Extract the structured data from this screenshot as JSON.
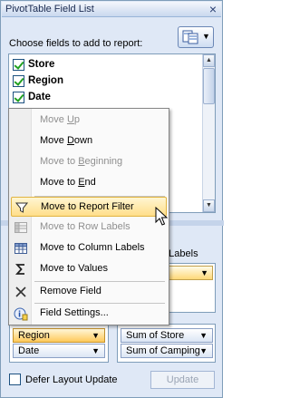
{
  "pane": {
    "title": "PivotTable Field List",
    "close_glyph": "×",
    "choose_label": "Choose fields to add to report:",
    "layout_button_icon": "field-list-layout-icon"
  },
  "fields": [
    {
      "label": "Store",
      "checked": true
    },
    {
      "label": "Region",
      "checked": true
    },
    {
      "label": "Date",
      "checked": true
    }
  ],
  "areas": {
    "drag_text": "D",
    "column_labels_header": "n Labels",
    "row_labels_header": "",
    "values_header": "",
    "row_chips": [
      {
        "label": "Region"
      },
      {
        "label": "Date"
      }
    ],
    "value_chips": [
      {
        "label": "Sum of Store"
      },
      {
        "label": "Sum of Camping"
      }
    ]
  },
  "footer": {
    "defer_label": "Defer Layout Update",
    "update_label": "Update"
  },
  "context_menu": {
    "items": [
      {
        "pre": "Move ",
        "ul": "U",
        "post": "p",
        "enabled": false,
        "icon": ""
      },
      {
        "pre": "Move ",
        "ul": "D",
        "post": "own",
        "enabled": true,
        "icon": ""
      },
      {
        "pre": "Move to ",
        "ul": "B",
        "post": "eginning",
        "enabled": false,
        "icon": ""
      },
      {
        "pre": "Move to ",
        "ul": "E",
        "post": "nd",
        "enabled": true,
        "icon": ""
      },
      {
        "pre": "Move to Report Filter",
        "ul": "",
        "post": "",
        "enabled": true,
        "icon": "filter-icon",
        "highlighted": true
      },
      {
        "pre": "Move to Row Labels",
        "ul": "",
        "post": "",
        "enabled": false,
        "icon": "row-labels-icon"
      },
      {
        "pre": "Move to Column Labels",
        "ul": "",
        "post": "",
        "enabled": true,
        "icon": "column-labels-icon"
      },
      {
        "pre": "Move to Values",
        "ul": "",
        "post": "",
        "enabled": true,
        "icon": "sigma-icon"
      },
      {
        "pre": "Remove Field",
        "ul": "",
        "post": "",
        "enabled": true,
        "icon": "remove-icon"
      },
      {
        "pre": "Field Settings...",
        "ul": "",
        "post": "",
        "enabled": true,
        "icon": "field-settings-icon"
      }
    ]
  }
}
